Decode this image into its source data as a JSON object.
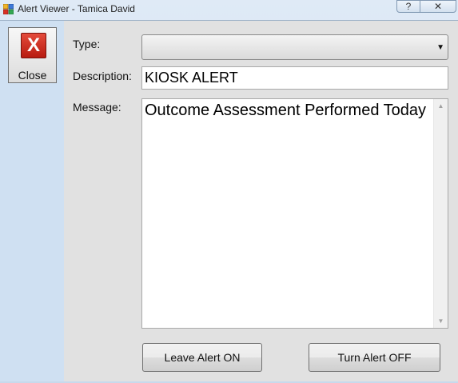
{
  "window": {
    "title": "Alert Viewer - Tamica David",
    "help_glyph": "?",
    "close_glyph": "✕"
  },
  "toolbar": {
    "close_label": "Close",
    "close_glyph": "X"
  },
  "form": {
    "type_label": "Type:",
    "type_value": "",
    "description_label": "Description:",
    "description_value": "KIOSK ALERT",
    "message_label": "Message:",
    "message_value": "Outcome Assessment Performed Today"
  },
  "actions": {
    "leave_on_label": "Leave Alert ON",
    "turn_off_label": "Turn Alert OFF"
  },
  "icons": {
    "dropdown": "chevron-down-icon",
    "app": "app-window-icon"
  },
  "colors": {
    "close_red": "#d0281b",
    "panel_blue": "#cfe0f2"
  }
}
